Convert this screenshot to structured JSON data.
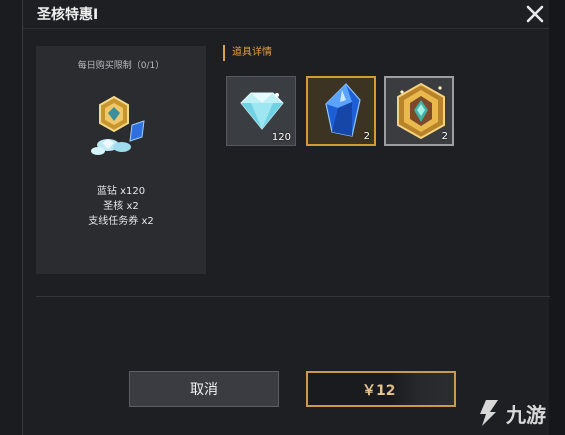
{
  "dialog": {
    "title": "圣核特惠I",
    "close_icon": "close-x-icon"
  },
  "bundle": {
    "purchase_limit": "每日购买限制（0/1）",
    "icon": "bundle-gem-icon",
    "contents": [
      "蓝钻 x120",
      "圣核 x2",
      "支线任务券 x2"
    ]
  },
  "details": {
    "label": "道具详情",
    "accent_color": "#d9a24a",
    "items": [
      {
        "icon": "blue-diamond-icon",
        "qty": "120"
      },
      {
        "icon": "blue-crystal-icon",
        "qty": "2"
      },
      {
        "icon": "holy-core-emblem-icon",
        "qty": "2"
      }
    ]
  },
  "buttons": {
    "cancel_label": "取消",
    "buy_label": "￥12"
  },
  "watermark": {
    "text": "九游"
  }
}
